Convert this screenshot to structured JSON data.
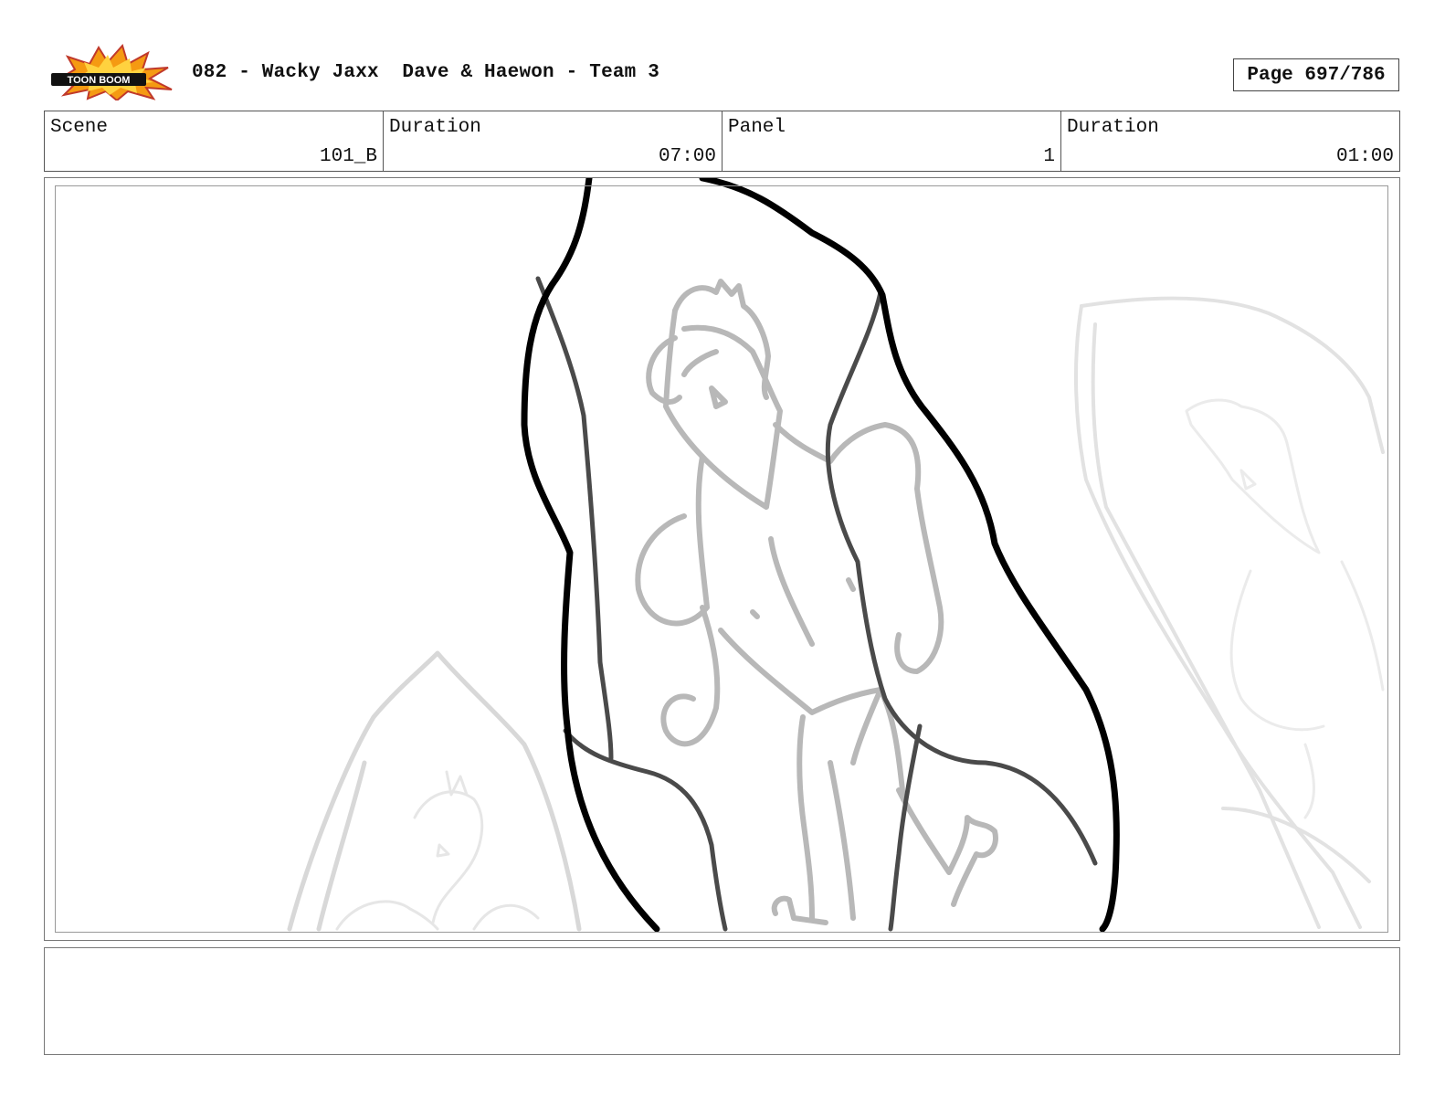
{
  "header": {
    "logo": {
      "icon": "toon-boom-logo",
      "text": "TOON BOOM"
    },
    "title": "082 - Wacky Jaxx  Dave & Haewon - Team 3",
    "page_label": "Page 697/786"
  },
  "info": {
    "scene_label": "Scene",
    "scene_value": "101_B",
    "scene_duration_label": "Duration",
    "scene_duration_value": "07:00",
    "panel_label": "Panel",
    "panel_value": "1",
    "panel_duration_label": "Duration",
    "panel_duration_value": "01:00"
  },
  "panel": {
    "art_icon": "storyboard-sketch-image"
  },
  "notes": {
    "text": ""
  }
}
